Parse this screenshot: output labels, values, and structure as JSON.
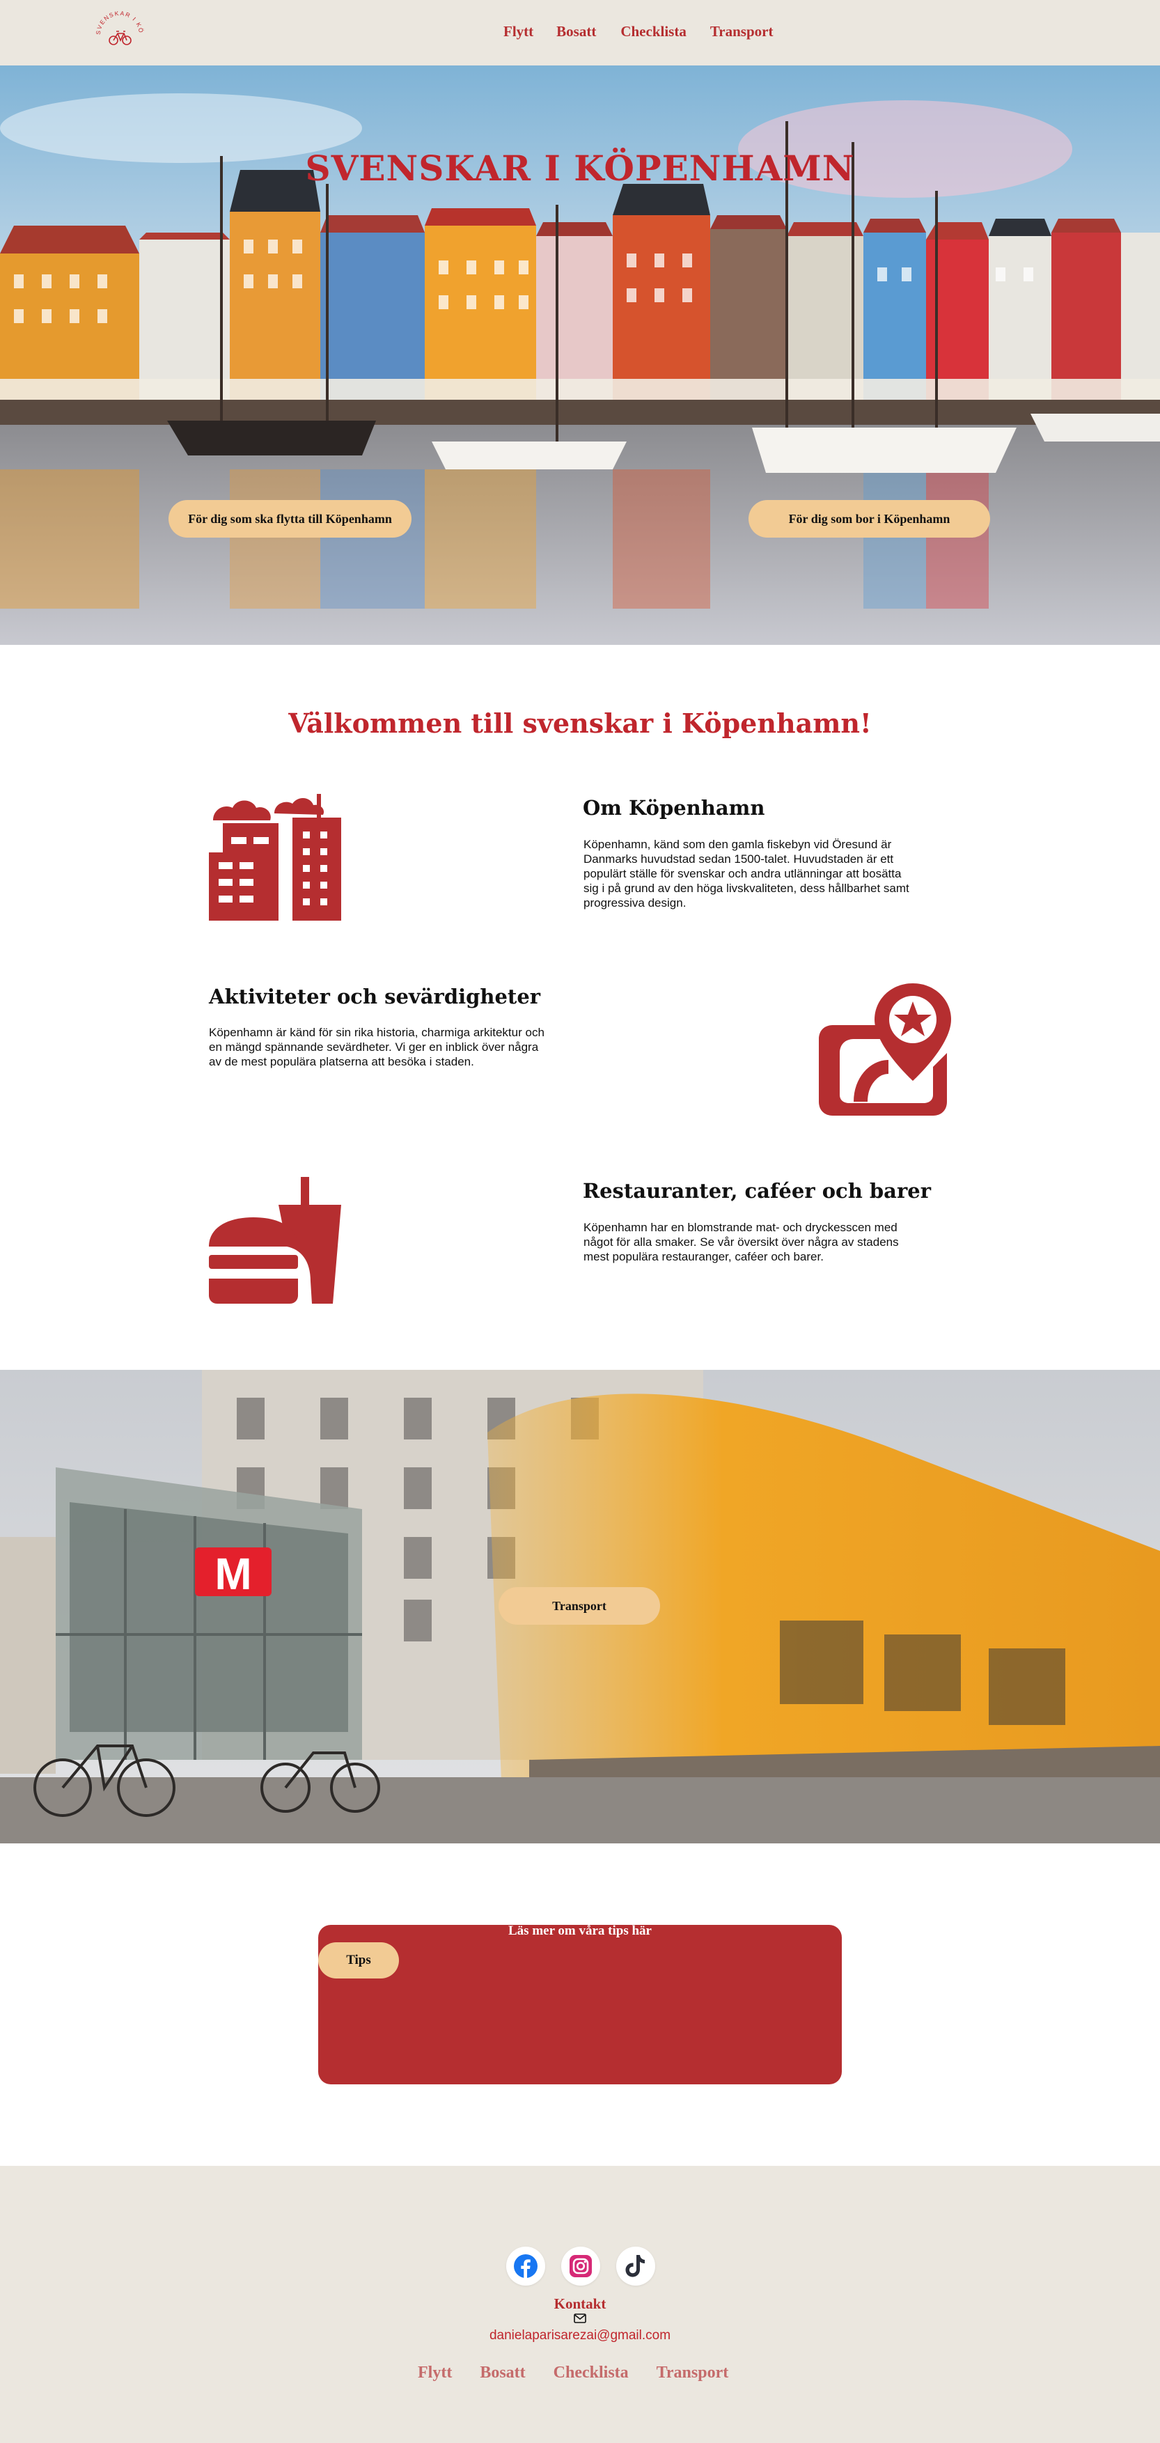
{
  "header": {
    "logo_text": "SVENSKAR I KÖPENHAMN",
    "nav": [
      "Flytt",
      "Bosatt",
      "Checklista",
      "Transport"
    ]
  },
  "hero": {
    "title": "SVENSKAR I KÖPENHAMN",
    "button_flytta": "För dig som ska flytta till Köpenhamn",
    "button_bor": "För dig som bor i Köpenhamn"
  },
  "welcome": {
    "title": "Välkommen till svenskar i Köpenhamn!"
  },
  "features": [
    {
      "icon": "city-buildings-icon",
      "title": "Om Köpenhamn",
      "text_lines": [
        "Köpenhamn, känd som den gamla fiskebyn vid Öresund är",
        "Danmarks huvudstad sedan 1500-talet. Huvudstaden är ett",
        "populärt ställe för svenskar och andra utlänningar att bosätta",
        "sig i på grund av den höga livskvaliteten, dess hållbarhet samt",
        "progressiva design."
      ]
    },
    {
      "icon": "map-star-pin-icon",
      "title": "Aktiviteter och sevärdigheter",
      "text_lines": [
        "Köpenhamn är känd för sin rika historia, charmiga arkitektur och",
        "en mängd spännande sevärdheter. Vi ger en inblick över några",
        "av de mest populära platserna att besöka i staden."
      ]
    },
    {
      "icon": "burger-drink-icon",
      "title": "Restauranter, caféer och barer",
      "text_lines": [
        "Köpenhamn har en blomstrande mat- och dryckesscen med",
        "något för alla smaker. Se vår översikt över några av stadens",
        "mest populära restauranger, caféer och barer."
      ]
    }
  ],
  "transport": {
    "button": "Transport",
    "metro_sign": "M"
  },
  "tips": {
    "heading": "Läs mer om våra tips här",
    "button": "Tips"
  },
  "footer": {
    "social": [
      "facebook-icon",
      "instagram-icon",
      "tiktok-icon"
    ],
    "kontakt": "Kontakt",
    "email": "danielaparisarezai@gmail.com",
    "nav": [
      "Flytt",
      "Bosatt",
      "Checklista",
      "Transport"
    ]
  },
  "colors": {
    "brand_red": "#b52e30",
    "title_red": "#c0262d",
    "pill_beige": "#f2cb94",
    "header_bg": "#ebe7df"
  }
}
